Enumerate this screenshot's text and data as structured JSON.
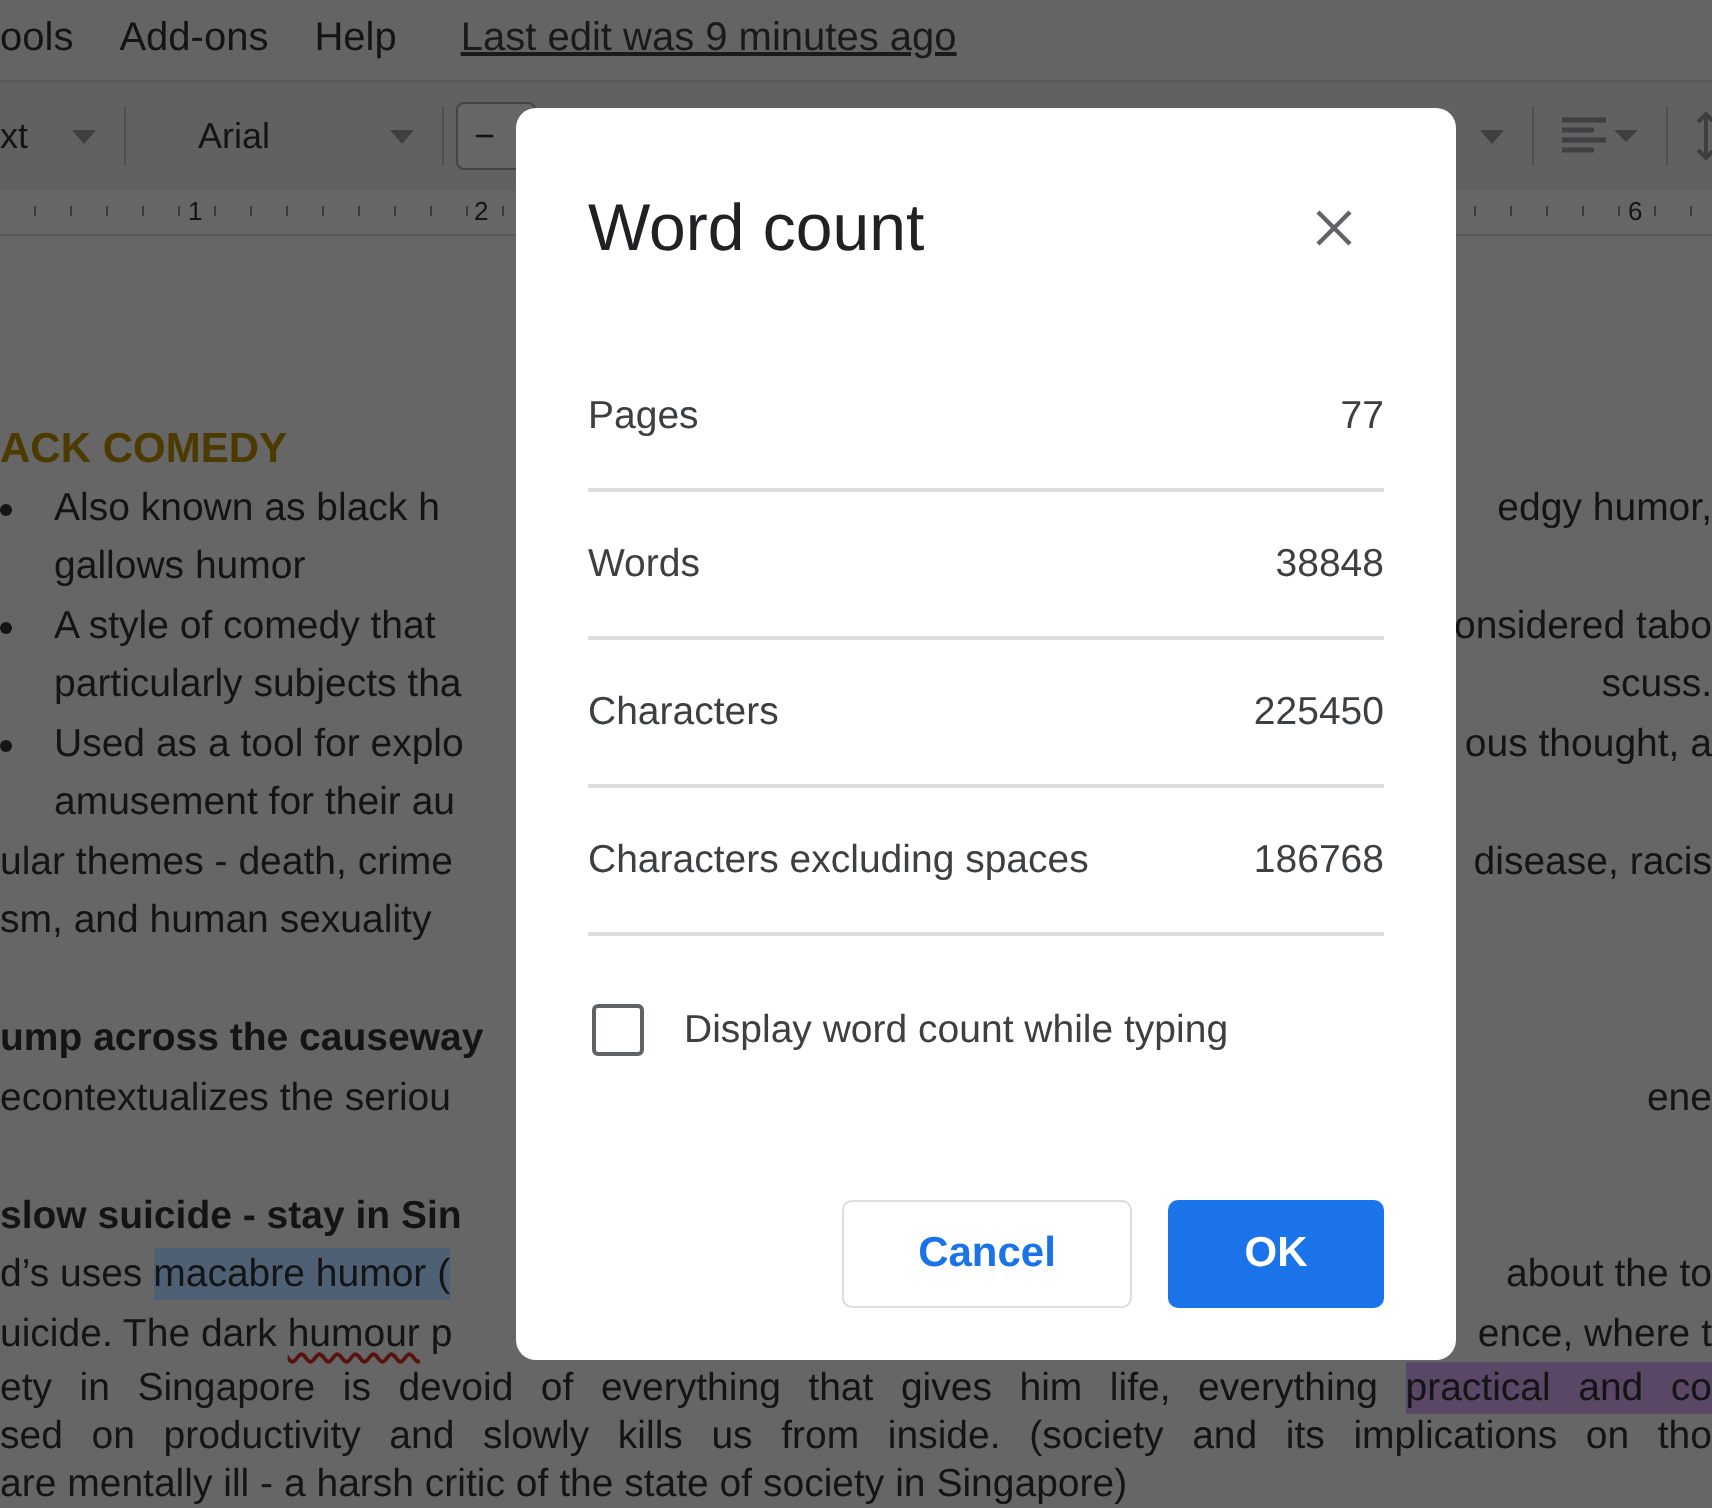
{
  "menu": {
    "items": [
      "ools",
      "Add-ons",
      "Help"
    ],
    "last_edit": "Last edit was 9 minutes ago"
  },
  "toolbar": {
    "style": "xt",
    "font": "Arial",
    "minus": "−"
  },
  "ruler": [
    "1",
    "2",
    "6"
  ],
  "document": [
    {
      "kind": "heading",
      "left": [
        {
          "kind": "plain",
          "text": "ACK COMEDY"
        }
      ]
    },
    {
      "kind": "bullet",
      "left": [
        {
          "kind": "plain",
          "text": "Also known as black h"
        }
      ],
      "right": "edgy humor,"
    },
    {
      "kind": "indent",
      "left": [
        {
          "kind": "plain",
          "text": "gallows humor"
        }
      ]
    },
    {
      "kind": "bullet",
      "left": [
        {
          "kind": "plain",
          "text": "A style of comedy that"
        }
      ],
      "right": "onsidered tabo"
    },
    {
      "kind": "indent",
      "left": [
        {
          "kind": "plain",
          "text": "particularly subjects tha"
        }
      ],
      "right": "scuss."
    },
    {
      "kind": "bullet",
      "left": [
        {
          "kind": "plain",
          "text": "Used as a tool for explo"
        }
      ],
      "right": "ous thought, a"
    },
    {
      "kind": "indent",
      "left": [
        {
          "kind": "plain",
          "text": "amusement for their au"
        }
      ]
    },
    {
      "kind": "plain",
      "left": [
        {
          "kind": "plain",
          "text": "ular themes - death, crime"
        }
      ],
      "right": "disease, racis"
    },
    {
      "kind": "plain",
      "left": [
        {
          "kind": "plain",
          "text": "sm, and human sexuality"
        }
      ]
    },
    {
      "kind": "subheading",
      "left": [
        {
          "kind": "plain",
          "text": "ump across the causeway"
        }
      ]
    },
    {
      "kind": "plain",
      "left": [
        {
          "kind": "plain",
          "text": "econtextualizes the seriou"
        }
      ],
      "right": "ene"
    },
    {
      "kind": "subheading",
      "left": [
        {
          "kind": "plain",
          "text": "slow suicide - stay in Sin"
        }
      ]
    },
    {
      "kind": "plain",
      "left": [
        {
          "kind": "plain",
          "text": "d’s uses "
        },
        {
          "kind": "highlight",
          "text": "macabre humor (",
          "color": "#4e6073"
        }
      ],
      "right": "about the to"
    },
    {
      "kind": "plain",
      "left": [
        {
          "kind": "plain",
          "text": "uicide. The dark "
        },
        {
          "kind": "misspelled",
          "text": "humour"
        },
        {
          "kind": "plain",
          "text": " p"
        }
      ],
      "right": "ence, where t"
    },
    {
      "kind": "justified",
      "left": [
        {
          "kind": "plain",
          "text": "ety in Singapore is devoid of everything that gives him life, everything "
        },
        {
          "kind": "highlight",
          "text": "practical and co",
          "color": "#5a4766"
        }
      ]
    },
    {
      "kind": "justified",
      "left": [
        {
          "kind": "plain",
          "text": "sed on productivity and slowly kills us from inside. (society and its implications on tho"
        }
      ]
    },
    {
      "kind": "plain",
      "left": [
        {
          "kind": "plain",
          "text": "are mentally ill - a harsh critic of the state of society in Singapore)"
        }
      ]
    }
  ],
  "dialog": {
    "title": "Word count",
    "stats": [
      {
        "label": "Pages",
        "value": "77"
      },
      {
        "label": "Words",
        "value": "38848"
      },
      {
        "label": "Characters",
        "value": "225450"
      },
      {
        "label": "Characters excluding spaces",
        "value": "186768"
      }
    ],
    "checkbox": {
      "label": "Display word count while typing",
      "checked": false
    },
    "buttons": [
      {
        "kind": "secondary",
        "label": "Cancel"
      },
      {
        "kind": "primary",
        "label": "OK"
      }
    ]
  }
}
